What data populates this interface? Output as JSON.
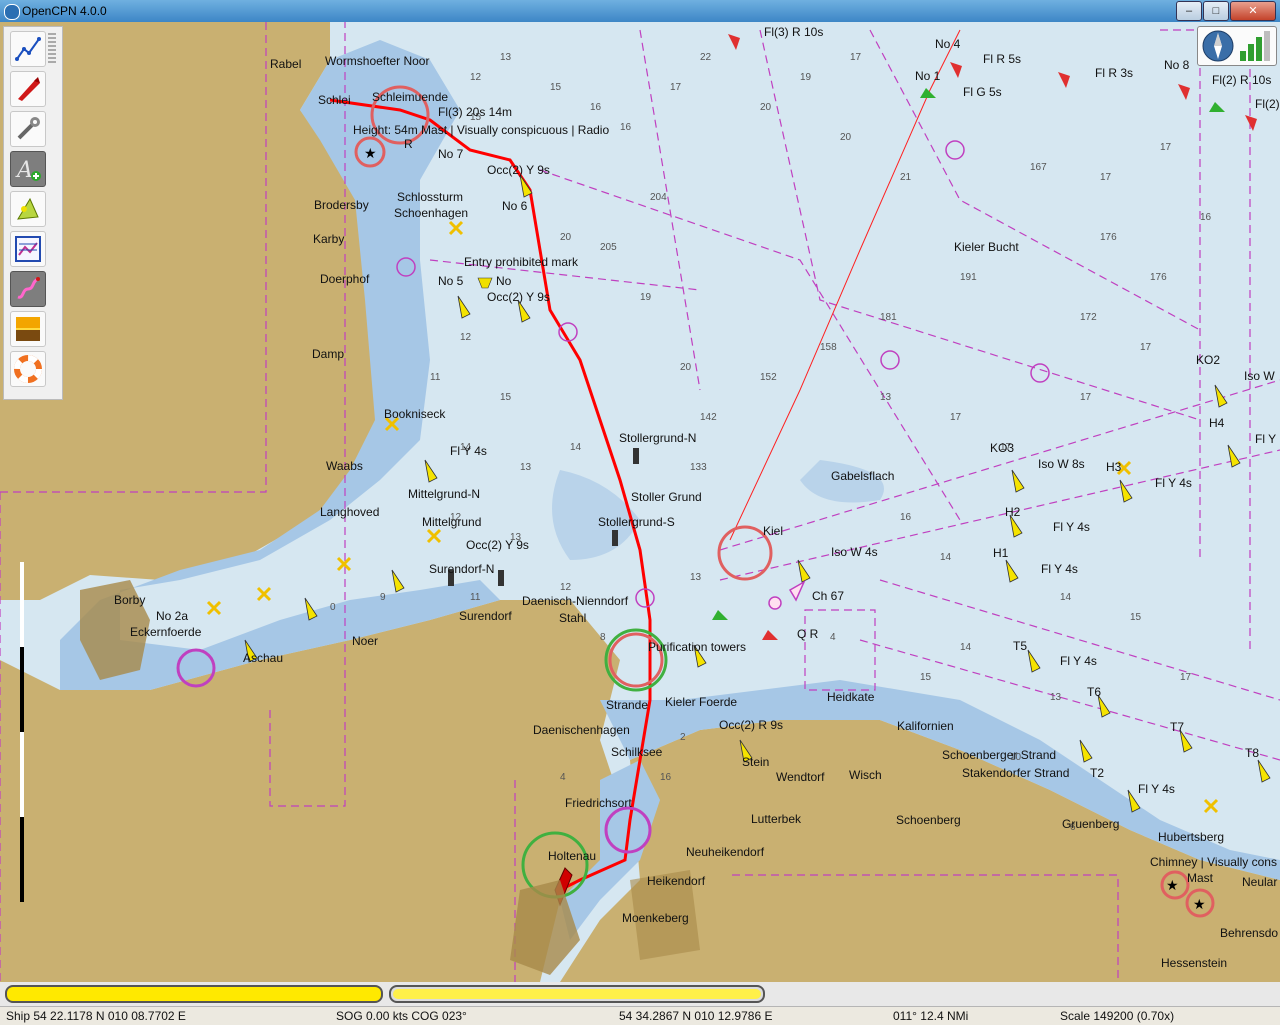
{
  "window": {
    "title": "OpenCPN 4.0.0",
    "buttons": {
      "minimize": "–",
      "maximize": "□",
      "close": "✕"
    }
  },
  "toolbar": {
    "items": [
      {
        "name": "route-manager",
        "icon": "route-icon"
      },
      {
        "name": "ship-tracking",
        "icon": "ship-icon"
      },
      {
        "name": "settings",
        "icon": "wrench-icon"
      },
      {
        "name": "text-tool",
        "icon": "text-plus-icon",
        "active": true
      },
      {
        "name": "ais-toggle",
        "icon": "ais-icon"
      },
      {
        "name": "chart-info",
        "icon": "chart-info-icon"
      },
      {
        "name": "track-toggle",
        "icon": "track-icon",
        "active": true
      },
      {
        "name": "color-scheme",
        "icon": "sunrise-icon"
      },
      {
        "name": "mob",
        "icon": "lifebuoy-icon"
      }
    ]
  },
  "chart": {
    "labels": [
      "Rabel",
      "Wormshoefter Noor",
      "Schlei",
      "Schleimuende",
      "Fl(3) 20s 14m",
      "Height: 54m Mast | Visually conspicuous | Radio",
      "R",
      "No 7",
      "Occ(2) Y 9s",
      "Schlossturm",
      "Schoenhagen",
      "Brodersby",
      "Karby",
      "Doerphof",
      "Damp",
      "Bookniseck",
      "Waabs",
      "Fl Y 4s",
      "Mittelgrund-N",
      "Mittelgrund",
      "Langhoved",
      "Occ(2) Y 9s",
      "Surendorf-N",
      "Surendorf",
      "Borby",
      "No 2a",
      "Eckernfoerde",
      "Aschau",
      "Noer",
      "Entry prohibited mark",
      "No 5",
      "No",
      "Occ(2) Y 9s",
      "No 6",
      "Stollergrund-N",
      "Stoller Grund",
      "Stollergrund-S",
      "Daenisch-Nienndorf",
      "Stahl",
      "Purification towers",
      "Strande",
      "Kieler Foerde",
      "Daenischenhagen",
      "Schilksee",
      "Friedrichsort",
      "Holtenau",
      "Heikendorf",
      "Moenkeberg",
      "Neuheikendorf",
      "Kiel",
      "Iso W 4s",
      "Ch 67",
      "Q R",
      "Gabelsflach",
      "Heidkate",
      "Kalifornien",
      "Occ(2) R 9s",
      "Stein",
      "Wendtorf",
      "Wisch",
      "Lutterbek",
      "Schoenberg",
      "Schoenberger Strand",
      "Stakendorfer Strand",
      "Gruenberg",
      "Hubertsberg",
      "Chimney | Visually cons",
      "Mast",
      "Neular",
      "Behrensdo",
      "Hessenstein",
      "Fl(3) R 10s",
      "No 4",
      "Fl R 5s",
      "No 1",
      "Fl G 5s",
      "Fl R 3s",
      "No 8",
      "Fl(2) R 10s",
      "Fl(2)",
      "Kieler Bucht",
      "KO2",
      "Iso W",
      "H4",
      "Fl Y",
      "KO3",
      "Iso W 8s",
      "H3",
      "Fl Y 4s",
      "H2",
      "Fl Y 4s",
      "H1",
      "Fl Y 4s",
      "T5",
      "Fl Y 4s",
      "T6",
      "T7",
      "T8",
      "T2",
      "Fl Y 4s"
    ]
  },
  "progress": {
    "primary_fill": 1.0,
    "secondary_fill": 1.0
  },
  "status": {
    "ship": "Ship 54 22.1178 N   010 08.7702 E",
    "sog_cog": "SOG 0.00 kts   COG 023°",
    "cursor": "54 34.2867 N   010 12.9786 E",
    "bearing": "011°  12.4 NMi",
    "scale": "Scale 149200 (0.70x)"
  },
  "colors": {
    "land": "#c9b071",
    "shallow": "#a8c8e8",
    "deep": "#d8e8f2",
    "route": "#ff0000",
    "nav_magenta": "#c040c0"
  }
}
